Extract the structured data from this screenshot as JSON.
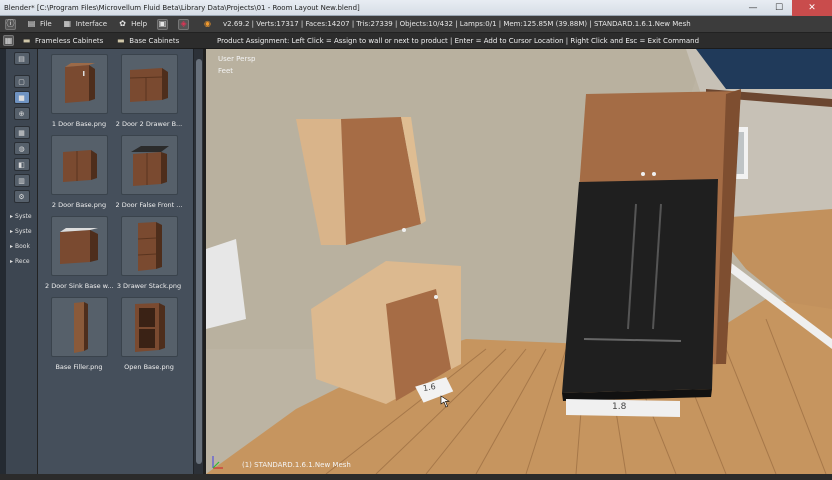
{
  "window": {
    "title": "Blender* [C:\\Program Files\\Microvellum Fluid Beta\\Library Data\\Projects\\01 - Room Layout New.blend]",
    "controls": {
      "minimize": "—",
      "maximize": "☐",
      "close": "✕"
    }
  },
  "infobar": {
    "menu_file": "File",
    "menu_interface": "Interface",
    "menu_help": "Help",
    "stats": "v2.69.2 | Verts:17317 | Faces:14207 | Tris:27339 | Objects:10/432 | Lamps:0/1 | Mem:125.85M (39.88M) | STANDARD.1.6.1.New Mesh"
  },
  "header": {
    "tab_frameless": "Frameless Cabinets",
    "tab_base": "Base Cabinets",
    "product_message": "Product Assignment: Left Click = Assign to wall or next to product | Enter = Add to Cursor Location | Right Click and Esc = Exit Command"
  },
  "sidebar": {
    "items": [
      "Syste",
      "Syste",
      "Book",
      "Rece"
    ]
  },
  "browser": {
    "items": [
      {
        "label": "1 Door Base.png"
      },
      {
        "label": "2 Door 2 Drawer B..."
      },
      {
        "label": "2 Door Base.png"
      },
      {
        "label": "2 Door False Front ..."
      },
      {
        "label": "2 Door Sink Base w..."
      },
      {
        "label": "3 Drawer Stack.png"
      },
      {
        "label": "Base Filler.png"
      },
      {
        "label": "Open Base.png"
      }
    ]
  },
  "viewport": {
    "view_name": "User Persp",
    "units": "Feet",
    "object_label": "(1) STANDARD.1.6.1.New Mesh",
    "dim_left": "1.6",
    "dim_right": "1.8"
  },
  "colors": {
    "cabinet_light": "#d6b58a",
    "cabinet_dark": "#9a6541",
    "fridge": "#1e1e1e",
    "floor": "#c6955f"
  }
}
